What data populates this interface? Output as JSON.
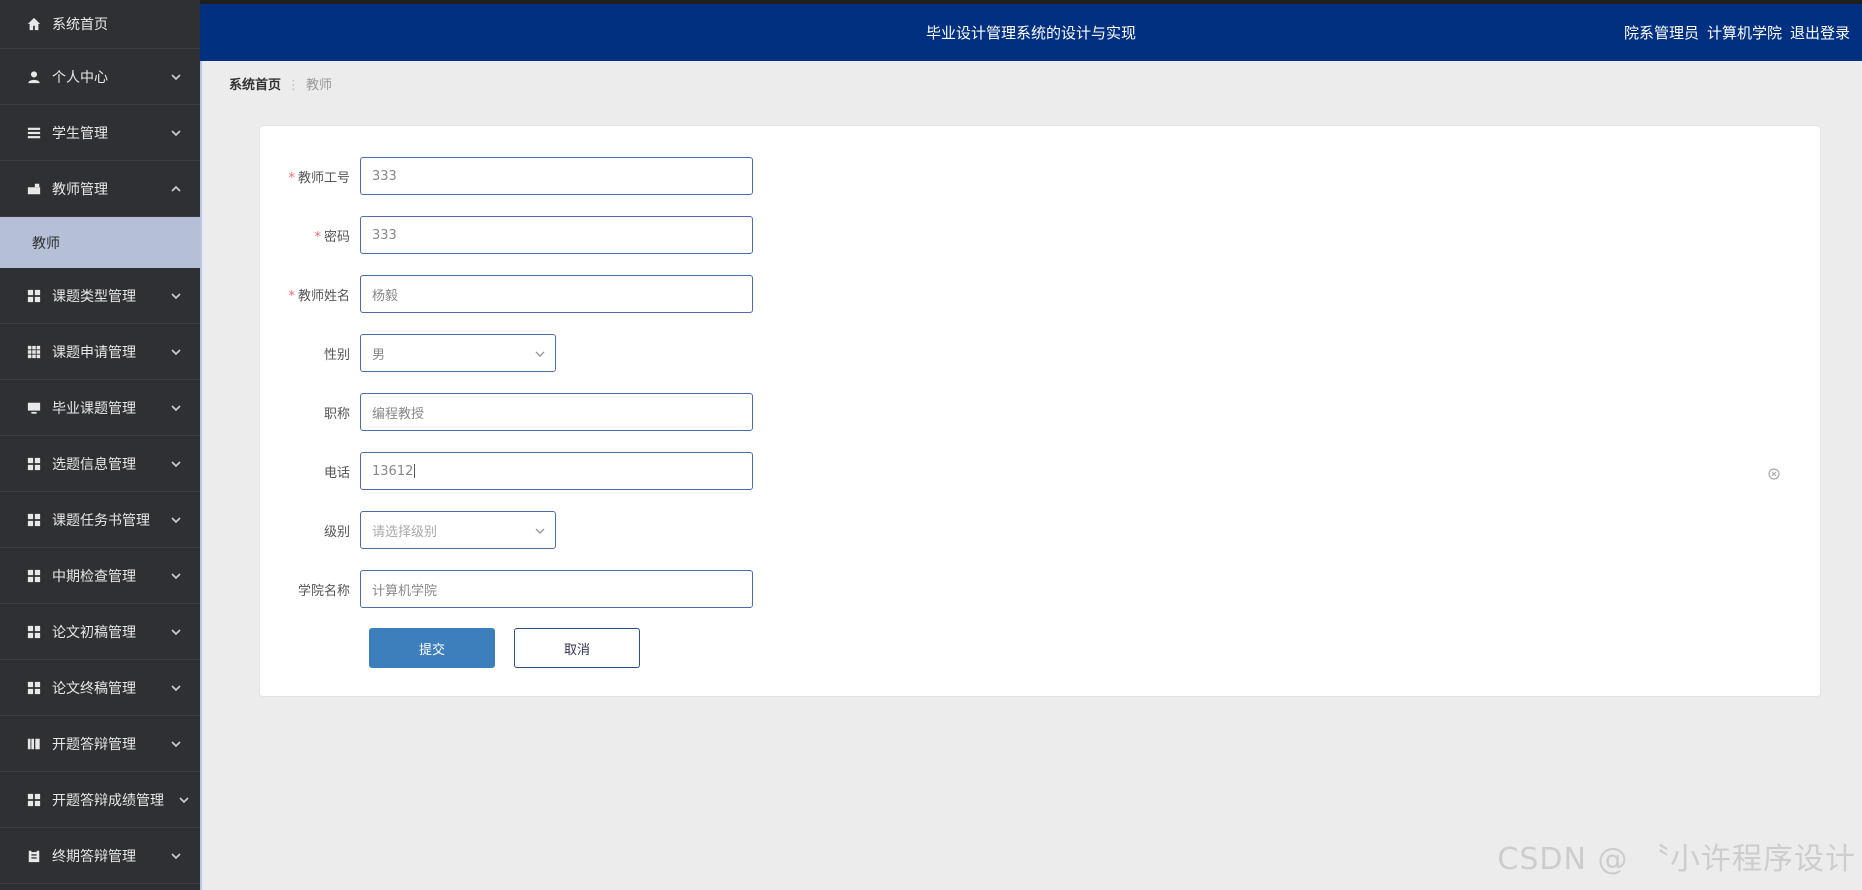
{
  "header": {
    "title": "毕业设计管理系统的设计与实现",
    "role": "院系管理员",
    "college": "计算机学院",
    "logout": "退出登录"
  },
  "sidebar": {
    "items": [
      {
        "label": "系统首页",
        "icon": "home-icon"
      },
      {
        "label": "个人中心",
        "icon": "user-icon"
      },
      {
        "label": "学生管理",
        "icon": "list-icon"
      },
      {
        "label": "教师管理",
        "icon": "teacher-icon"
      },
      {
        "label": "课题类型管理",
        "icon": "grid-icon"
      },
      {
        "label": "课题申请管理",
        "icon": "table-icon"
      },
      {
        "label": "毕业课题管理",
        "icon": "monitor-icon"
      },
      {
        "label": "选题信息管理",
        "icon": "grid-icon"
      },
      {
        "label": "课题任务书管理",
        "icon": "grid-icon"
      },
      {
        "label": "中期检查管理",
        "icon": "grid-icon"
      },
      {
        "label": "论文初稿管理",
        "icon": "grid-icon"
      },
      {
        "label": "论文终稿管理",
        "icon": "grid-icon"
      },
      {
        "label": "开题答辩管理",
        "icon": "book-icon"
      },
      {
        "label": "开题答辩成绩管理",
        "icon": "grid-icon"
      },
      {
        "label": "终期答辩管理",
        "icon": "clipboard-icon"
      }
    ],
    "active_sub": "教师"
  },
  "breadcrumb": {
    "home": "系统首页",
    "current": "教师"
  },
  "form": {
    "teacher_id": {
      "label": "教师工号",
      "value": "333"
    },
    "password": {
      "label": "密码",
      "value": "333"
    },
    "teacher_name": {
      "label": "教师姓名",
      "value": "杨毅"
    },
    "gender": {
      "label": "性别",
      "value": "男"
    },
    "title": {
      "label": "职称",
      "value": "编程教授"
    },
    "phone": {
      "label": "电话",
      "value": "13612"
    },
    "level": {
      "label": "级别",
      "placeholder": "请选择级别"
    },
    "college": {
      "label": "学院名称",
      "value": "计算机学院"
    },
    "submit": "提交",
    "cancel": "取消"
  },
  "watermark": "CSDN @ 〝小许程序设计"
}
